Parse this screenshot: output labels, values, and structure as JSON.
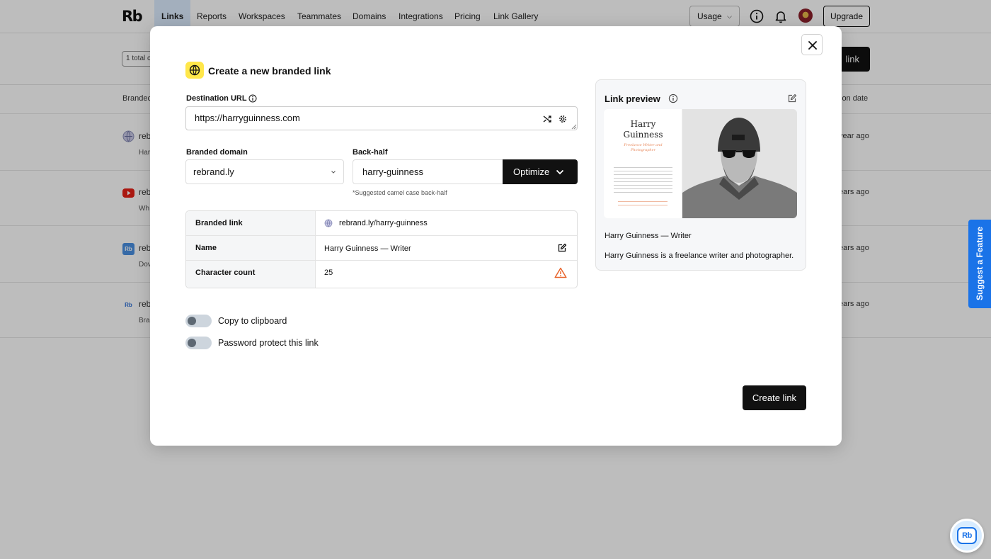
{
  "app": {
    "logo": "Rb",
    "nav": [
      {
        "label": "Links",
        "active": true
      },
      {
        "label": "Reports"
      },
      {
        "label": "Workspaces"
      },
      {
        "label": "Teammates"
      },
      {
        "label": "Domains"
      },
      {
        "label": "Integrations"
      },
      {
        "label": "Pricing"
      },
      {
        "label": "Link Gallery"
      }
    ],
    "usage_label": "Usage",
    "upgrade_label": "Upgrade",
    "total_chip": "1 total c",
    "new_link_button": "link",
    "columns": {
      "branded": "Brandec",
      "date": "ion date"
    },
    "rows": [
      {
        "title": "reb",
        "sub": "Har",
        "date": "year ago",
        "icon": "globe-icon"
      },
      {
        "title": "reb",
        "sub": "Wh",
        "date": "ears ago",
        "icon": "youtube-icon"
      },
      {
        "title": "reb",
        "sub": "Dov",
        "date": "ears ago",
        "icon": "rebrandly-icon"
      },
      {
        "title": "reb",
        "sub": "Bra",
        "date": "ears ago",
        "icon": "rebrandly-small-icon"
      }
    ],
    "suggest_feature": "Suggest a Feature",
    "chat_logo": "Rb"
  },
  "modal": {
    "title": "Create a new branded link",
    "destination": {
      "label": "Destination URL",
      "value": "https://harryguinness.com"
    },
    "domain": {
      "label": "Branded domain",
      "value": "rebrand.ly"
    },
    "backhalf": {
      "label": "Back-half",
      "value": "harry-guinness",
      "hint": "*Suggested camel case back-half"
    },
    "optimize_label": "Optimize",
    "table": [
      {
        "key": "Branded link",
        "value": "rebrand.ly/harry-guinness"
      },
      {
        "key": "Name",
        "value": "Harry Guinness — Writer"
      },
      {
        "key": "Character count",
        "value": "25"
      }
    ],
    "toggles": [
      {
        "label": "Copy to clipboard",
        "on": false
      },
      {
        "label": "Password protect this link",
        "on": false
      }
    ],
    "preview": {
      "title": "Link preview",
      "image_name": "Harry\nGuinness",
      "image_tagline": "Freelance Writer and Photographer",
      "link_title": "Harry Guinness — Writer",
      "description": "Harry Guinness is a freelance writer and photographer."
    },
    "create_label": "Create link"
  },
  "colors": {
    "accent": "#1a73e8",
    "badge": "#ffe74a",
    "warning": "#e8642c",
    "primary": "#111111"
  }
}
